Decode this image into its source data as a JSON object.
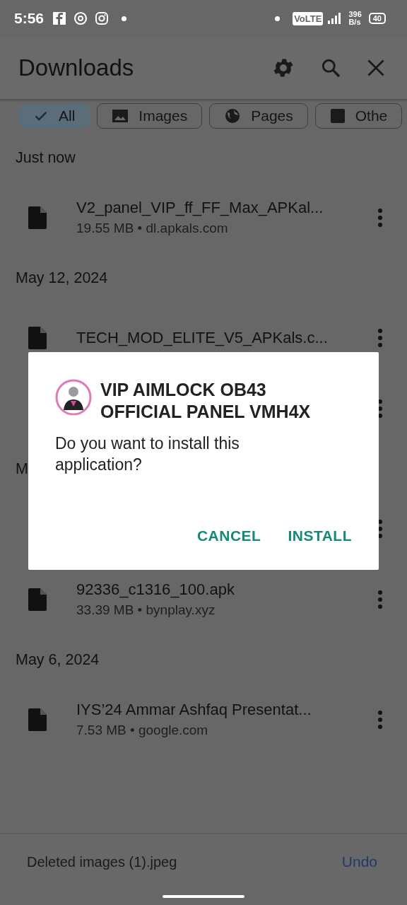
{
  "status_bar": {
    "time": "5:56",
    "network_badge": "VoLTE",
    "speed_value": "396",
    "speed_unit": "B/s",
    "battery": "40"
  },
  "header": {
    "title": "Downloads"
  },
  "filters": [
    {
      "label": "All",
      "selected": true,
      "kind": "all"
    },
    {
      "label": "Images",
      "selected": false,
      "kind": "images"
    },
    {
      "label": "Pages",
      "selected": false,
      "kind": "pages"
    },
    {
      "label": "Othe",
      "selected": false,
      "kind": "other"
    }
  ],
  "items": [
    {
      "kind": "date",
      "label": "Just now"
    },
    {
      "kind": "file",
      "title": "V2_panel_VIP_ff_FF_Max_APKal...",
      "subtitle": "19.55 MB • dl.apkals.com"
    },
    {
      "kind": "date",
      "label": "May 12, 2024"
    },
    {
      "kind": "file",
      "title": "TECH_MOD_ELITE_V5_APKals.c..."
    },
    {
      "kind": "file"
    },
    {
      "kind": "date",
      "label": "M"
    },
    {
      "kind": "file"
    },
    {
      "kind": "file",
      "title": "92336_c1316_100.apk",
      "subtitle": "33.39 MB • bynplay.xyz"
    },
    {
      "kind": "date",
      "label": "May 6, 2024"
    },
    {
      "kind": "file",
      "title": "IYS’24 Ammar Ashfaq Presentat...",
      "subtitle": "7.53 MB • google.com"
    }
  ],
  "dialog": {
    "title": "VIP AIMLOCK OB43 OFFICIAL PANEL VMH4X",
    "message": "Do you want to install this application?",
    "buttons": [
      "CANCEL",
      "INSTALL"
    ]
  },
  "snackbar": {
    "message": "Deleted images (1).jpeg",
    "action": "Undo"
  }
}
